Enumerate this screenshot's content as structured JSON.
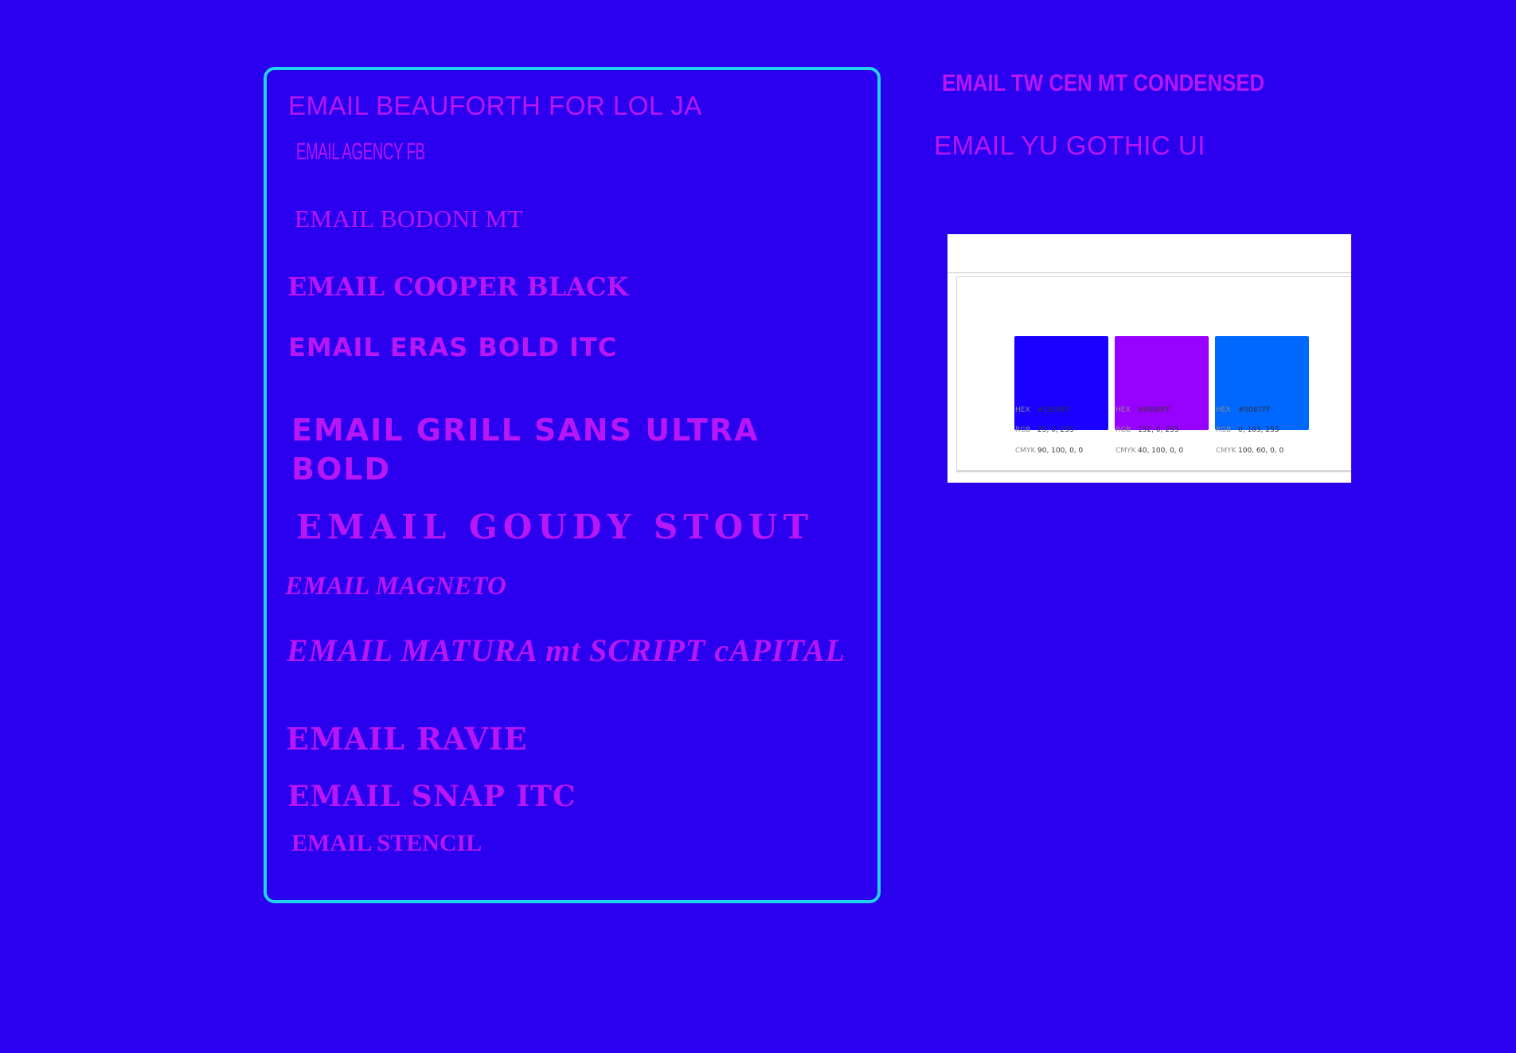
{
  "panel_samples": [
    "EMAIL BEAUFORTH FOR LOL JA",
    "EMAIL AGENCY FB",
    "EMAIL BODONI MT",
    "EMAIL COOPER BLACK",
    "EMAIL ERAS BOLD ITC",
    "EMAIL GRILL SANS ULTRA BOLD",
    "EMAIL GOUDY STOUT",
    "EMAIL MAGNETO",
    "EMAIL MATURA mt SCRIPT cAPITAL",
    "EMAIL RAVIE",
    "EMAIL SNAP ITC",
    "EMAIL STENCIL"
  ],
  "side_samples": [
    "EMAIL TW CEN MT CONDENSED",
    "EMAIL YU GOTHIC UI"
  ],
  "swatches": [
    {
      "hex_label": "HEX",
      "hex": "#1900FF",
      "rgb_label": "RGB",
      "rgb": "25, 0, 255",
      "cmyk_label": "CMYK",
      "cmyk": "90, 100, 0, 0",
      "color": "#1900ff"
    },
    {
      "hex_label": "HEX",
      "hex": "#9800FF",
      "rgb_label": "RGB",
      "rgb": "152, 0, 255",
      "cmyk_label": "CMYK",
      "cmyk": "40, 100, 0, 0",
      "color": "#9800ff"
    },
    {
      "hex_label": "HEX",
      "hex": "#0067FF",
      "rgb_label": "RGB",
      "rgb": "0, 103, 255",
      "cmyk_label": "CMYK",
      "cmyk": "100, 60, 0, 0",
      "color": "#0067ff"
    }
  ],
  "colors": {
    "background": "#2a00ee",
    "text": "#b716f6",
    "panel_border": "#21d2ee"
  }
}
